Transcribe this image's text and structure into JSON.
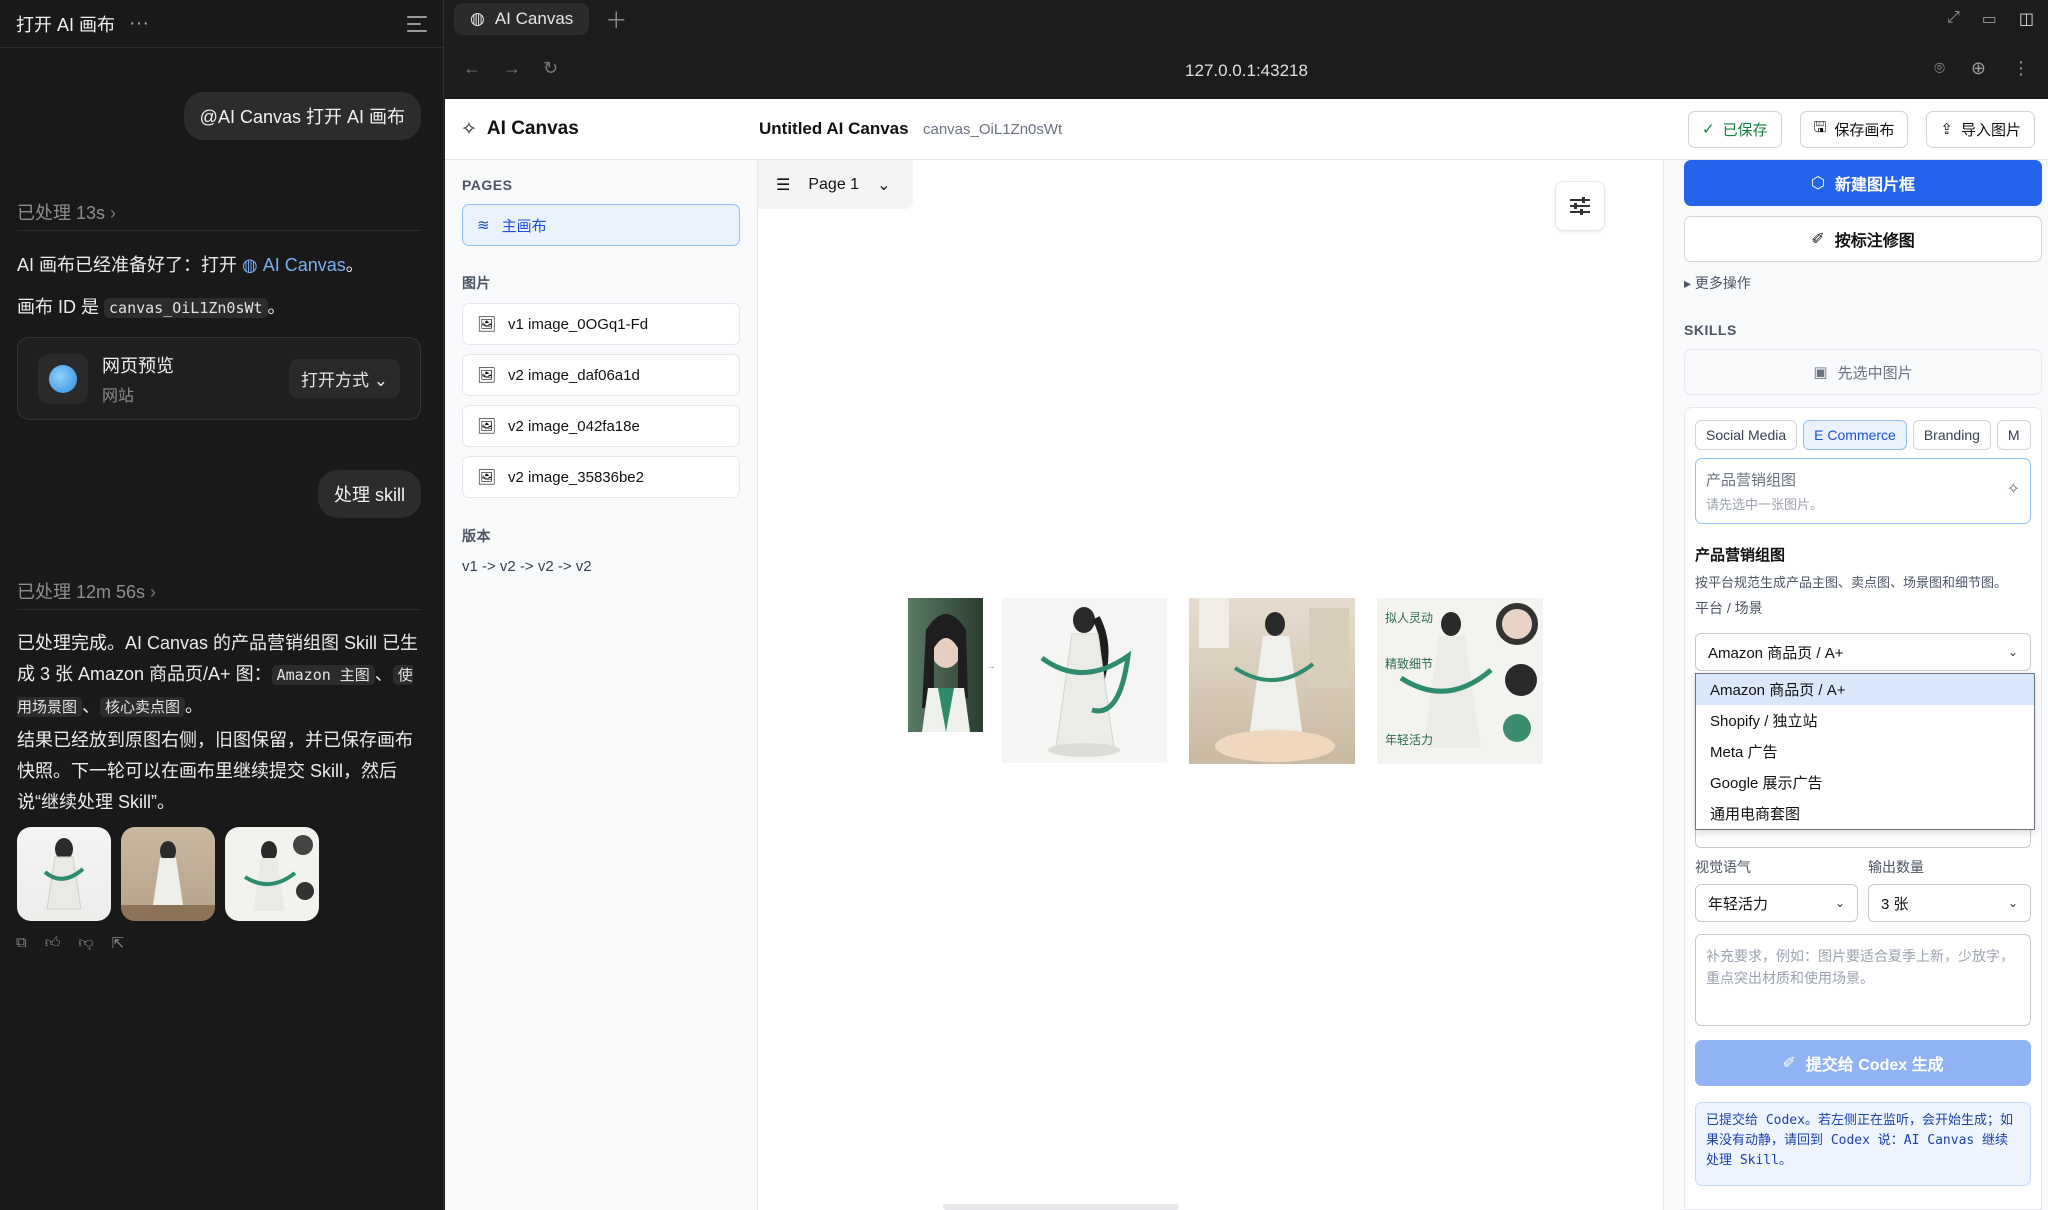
{
  "chat": {
    "title": "打开 AI 画布",
    "more": "···",
    "msg1": "@AI Canvas 打开 AI 画布",
    "proc1": "已处理 13s",
    "reply1_a": "AI 画布已经准备好了：打开 ",
    "reply1_link": "AI Canvas",
    "reply1_b": "。",
    "reply2_a": "画布 ID 是 ",
    "reply2_code": "canvas_OiL1Zn0sWt",
    "reply2_b": "。",
    "card_title": "网页预览",
    "card_sub": "网站",
    "card_open": "打开方式",
    "msg2": "处理 skill",
    "proc2": "已处理 12m 56s",
    "p1_a": "已处理完成。AI Canvas 的产品营销组图 Skill 已生成 3 张 Amazon 商品页/A+ 图：",
    "p1_c1": "Amazon 主图",
    "p1_sep": "、",
    "p1_c2": "使用场景图",
    "p1_sep2": "、",
    "p1_c3": "核心卖点图",
    "p1_end": "。",
    "p2": "结果已经放到原图右侧，旧图保留，并已保存画布快照。下一轮可以在画布里继续提交 Skill，然后说“继续处理 Skill”。"
  },
  "browser": {
    "tab_label": "AI Canvas",
    "url": "127.0.0.1:43218"
  },
  "app": {
    "logo": "AI Canvas",
    "canvas_title": "Untitled AI Canvas",
    "canvas_id": "canvas_OiL1Zn0sWt",
    "btn_saved": "已保存",
    "btn_save": "保存画布",
    "btn_import": "导入图片",
    "pages_heading": "PAGES",
    "page_main": "主画布",
    "images_heading": "图片",
    "images": [
      "v1 image_0OGq1-Fd",
      "v2 image_daf06a1d",
      "v2 image_042fa18e",
      "v2 image_35836be2"
    ],
    "versions_heading": "版本",
    "versions": "v1 -> v2 -> v2 -> v2",
    "page_selector": "Page 1",
    "new_frame": "新建图片框",
    "annotate": "按标注修图",
    "more_ops": "▸ 更多操作",
    "skills_heading": "SKILLS",
    "select_first": "先选中图片",
    "chips": [
      "Social Media",
      "E Commerce",
      "Branding",
      "M"
    ],
    "input_title": "产品营销组图",
    "input_hint": "请先选中一张图片。",
    "skill_title": "产品营销组图",
    "skill_desc": "按平台规范生成产品主图、卖点图、场景图和细节图。",
    "platform_label": "平台 / 场景",
    "platform_value": "Amazon 商品页 / A+",
    "platform_options": [
      "Amazon 商品页 / A+",
      "Shopify / 独立站",
      "Meta 广告",
      "Google 展示广告",
      "通用电商套图"
    ],
    "tone_label": "视觉语气",
    "tone_value": "年轻活力",
    "count_label": "输出数量",
    "count_value": "3 张",
    "extra_placeholder": "补充要求，例如：图片要适合夏季上新，少放字，重点突出材质和使用场景。",
    "submit": "提交给 Codex 生成",
    "notice": "已提交给 Codex。若左侧正在监听，会开始生成；如果没有动静，请回到 Codex 说：AI Canvas 继续处理 Skill。"
  },
  "colors": {
    "accent": "#2463eb",
    "saved": "#15803d",
    "link": "#79b0f5"
  }
}
